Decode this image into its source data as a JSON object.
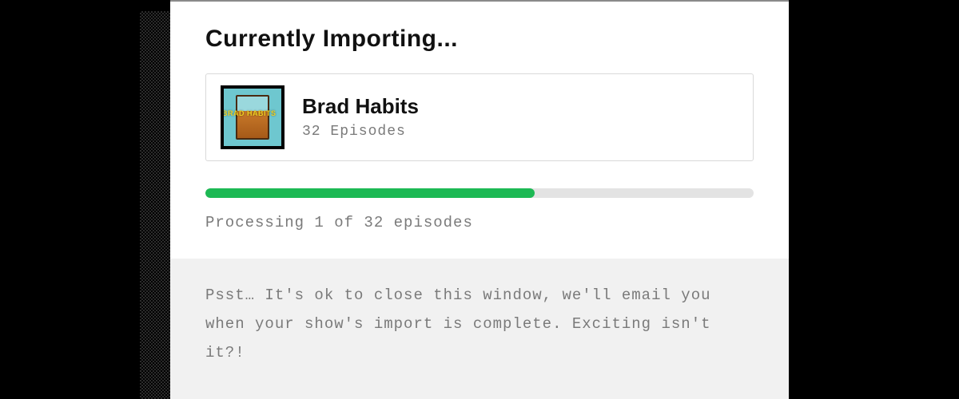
{
  "dialog": {
    "heading": "Currently Importing...",
    "show": {
      "artwork_label": "BRAD HABITS",
      "title": "Brad Habits",
      "episodes_line": "32 Episodes"
    },
    "progress": {
      "percent": 60,
      "status": "Processing 1 of 32 episodes"
    },
    "footer": "Psst… It's ok to close this window, we'll email you when your show's import is complete. Exciting isn't it?!"
  }
}
